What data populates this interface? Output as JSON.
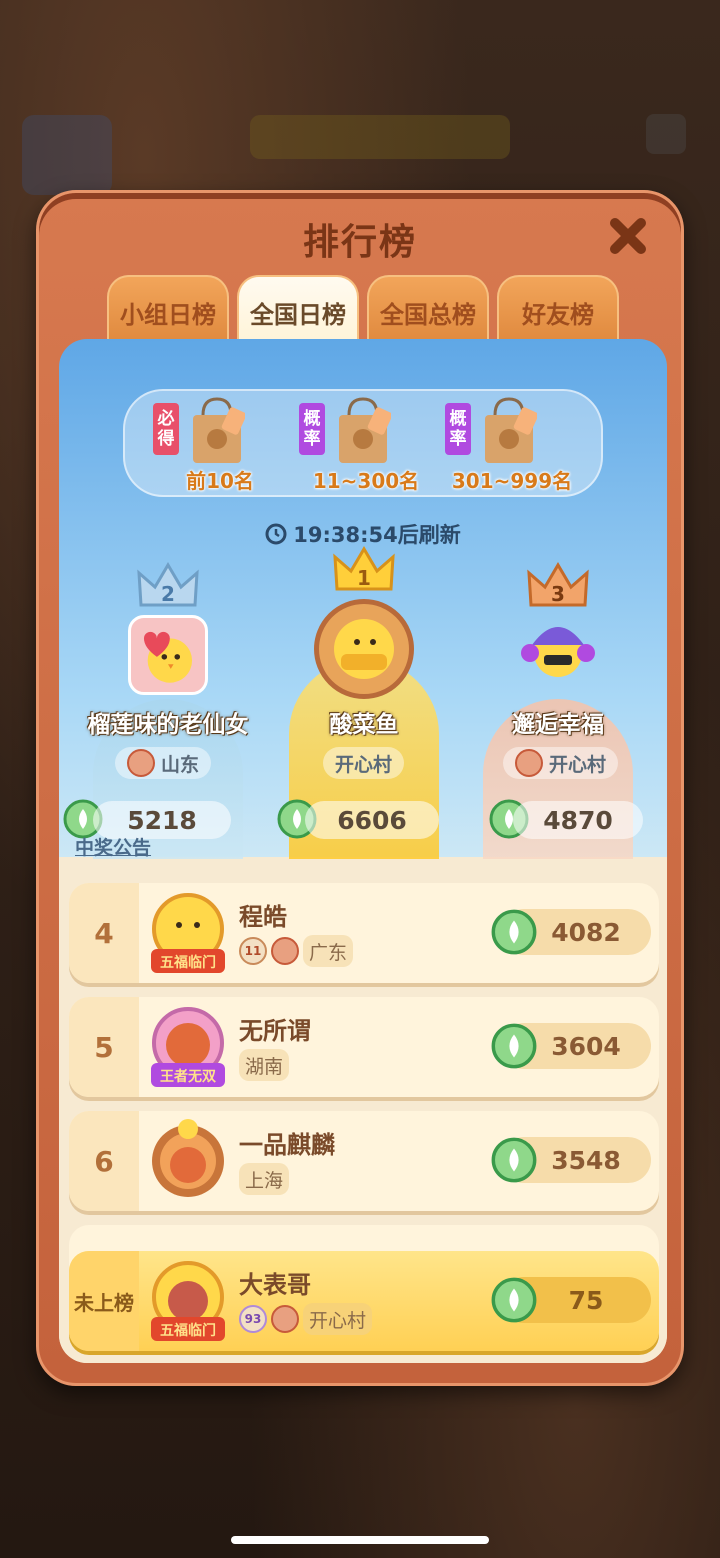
{
  "header": {
    "title": "排行榜"
  },
  "tabs": [
    {
      "label": "小组日榜"
    },
    {
      "label": "全国日榜",
      "active": true
    },
    {
      "label": "全国总榜"
    },
    {
      "label": "好友榜"
    }
  ],
  "rewards": [
    {
      "tag": "必得",
      "tag_color": "#e8506a",
      "label": "前10名"
    },
    {
      "tag": "概率",
      "tag_color": "#b04ae0",
      "label": "11~300名"
    },
    {
      "tag": "概率",
      "tag_color": "#b04ae0",
      "label": "301~999名"
    }
  ],
  "refresh_text": "19:38:54后刷新",
  "podium": [
    {
      "rank": "2",
      "name": "榴莲味的老仙女",
      "region": "山东",
      "score": "5218"
    },
    {
      "rank": "1",
      "name": "酸菜鱼",
      "region": "开心村",
      "score": "6606"
    },
    {
      "rank": "3",
      "name": "邂逅幸福",
      "region": "开心村",
      "score": "4870"
    }
  ],
  "notice_label": "中奖公告",
  "ranking": [
    {
      "rank": "4",
      "name": "程皓",
      "level": "11",
      "region": "广东",
      "score": "4082",
      "frame_label": "五福临门"
    },
    {
      "rank": "5",
      "name": "无所谓",
      "region": "湖南",
      "score": "3604",
      "frame_label": "王者无双"
    },
    {
      "rank": "6",
      "name": "一品麒麟",
      "region": "上海",
      "score": "3548"
    }
  ],
  "self": {
    "rank": "未上榜",
    "name": "大表哥",
    "level": "93",
    "region": "开心村",
    "score": "75",
    "frame_label": "五福临门"
  },
  "colors": {
    "panel": "#d7794f",
    "title": "#7a3516",
    "gem": "#6cc36a"
  }
}
